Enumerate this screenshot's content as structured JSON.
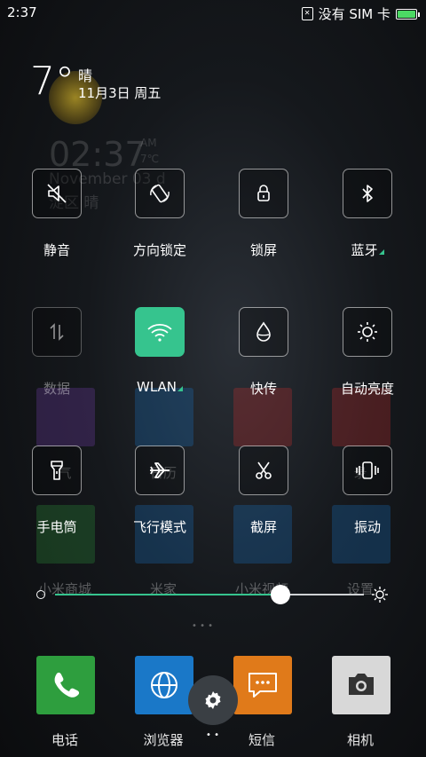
{
  "status": {
    "time": "2:37",
    "sim_text": "没有 SIM 卡",
    "sim_icon_glyph": "✕",
    "battery_color": "#4cd964"
  },
  "weather": {
    "temp": "7°",
    "condition": "晴",
    "date": "11月3日 周五"
  },
  "ghost_clock": {
    "time": "02:37",
    "ampm": "AM",
    "temp": "7℃",
    "date": "November 03 d",
    "location": "淀区 晴"
  },
  "toggles": [
    {
      "label": "静音",
      "icon": "mute-icon",
      "state": "off"
    },
    {
      "label": "方向锁定",
      "icon": "rotation-lock-icon",
      "state": "off"
    },
    {
      "label": "锁屏",
      "icon": "lock-icon",
      "state": "off"
    },
    {
      "label": "蓝牙",
      "icon": "bluetooth-icon",
      "state": "off",
      "has_more": true
    },
    {
      "label": "数据",
      "icon": "mobile-data-icon",
      "state": "disabled"
    },
    {
      "label": "WLAN",
      "icon": "wifi-icon",
      "state": "on",
      "has_more": true
    },
    {
      "label": "快传",
      "icon": "droplet-icon",
      "state": "off"
    },
    {
      "label": "自动亮度",
      "icon": "brightness-icon",
      "state": "off"
    },
    {
      "label": "手电筒",
      "icon": "flashlight-icon",
      "state": "off"
    },
    {
      "label": "飞行模式",
      "icon": "airplane-icon",
      "state": "off"
    },
    {
      "label": "截屏",
      "icon": "scissors-icon",
      "state": "off"
    },
    {
      "label": "振动",
      "icon": "vibrate-icon",
      "state": "off"
    }
  ],
  "ghost_apps": {
    "row1": [
      "气",
      "日历",
      "",
      "录"
    ],
    "row2": [
      "小米商城",
      "米家",
      "小米视频",
      "设置"
    ]
  },
  "brightness": {
    "level": 0.73,
    "accent": "#36c48e"
  },
  "page_dots": "• • •",
  "dock": [
    {
      "label": "电话",
      "icon": "phone-icon",
      "color": "#2e9e3e"
    },
    {
      "label": "浏览器",
      "icon": "browser-icon",
      "color": "#1a78c8"
    },
    {
      "label": "短信",
      "icon": "message-icon",
      "color": "#e07a1a"
    },
    {
      "label": "相机",
      "icon": "camera-icon",
      "color": "#d8d8d8"
    }
  ],
  "settings_dots": "• •",
  "colors": {
    "accent": "#36c48e"
  }
}
